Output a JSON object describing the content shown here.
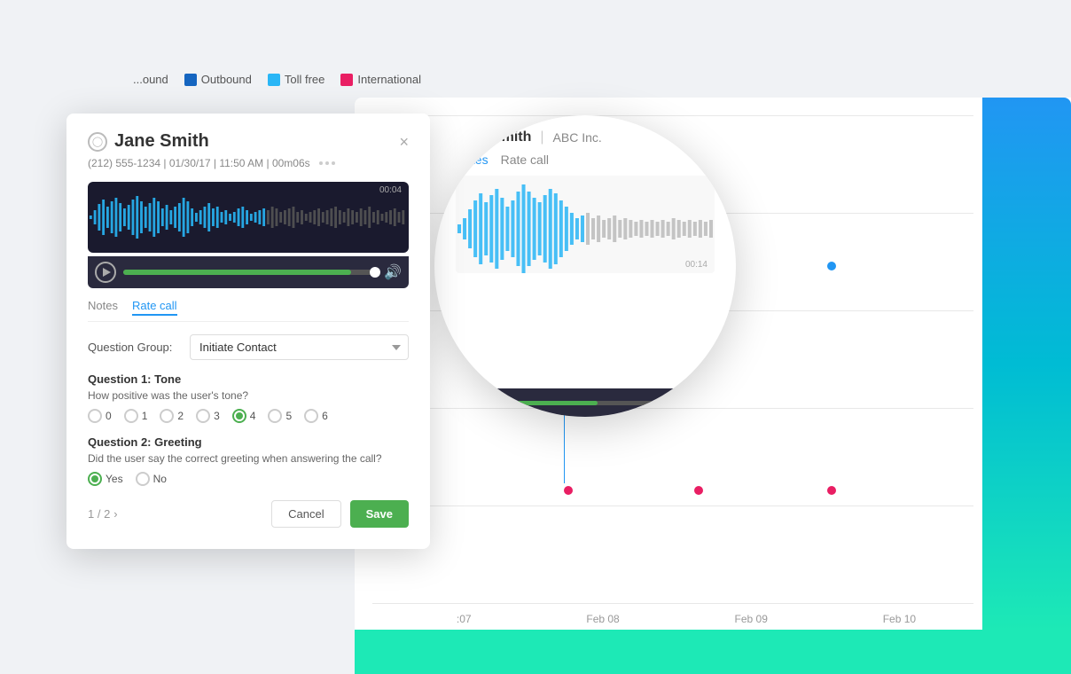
{
  "legend": {
    "items": [
      {
        "label": "Outbound",
        "color": "#1565C0"
      },
      {
        "label": "Toll free",
        "color": "#29B6F6"
      },
      {
        "label": "International",
        "color": "#E91E63"
      }
    ]
  },
  "modal": {
    "title": "Jane Smith",
    "close_label": "×",
    "meta": "(212) 555-1234 | 01/30/17 | 11:50 AM | 00m06s",
    "waveform_time": "00:04",
    "tabs": [
      {
        "label": "Notes",
        "active": false
      },
      {
        "label": "Rate call",
        "active": true
      }
    ],
    "form": {
      "question_group_label": "Question Group:",
      "question_group_value": "Initiate Contact",
      "questions": [
        {
          "title": "Question 1: Tone",
          "text": "How positive was the user's tone?",
          "type": "scale",
          "options": [
            "0",
            "1",
            "2",
            "3",
            "4",
            "5",
            "6"
          ],
          "selected": "4"
        },
        {
          "title": "Question 2: Greeting",
          "text": "Did the user say the correct greeting when answering the call?",
          "type": "yesno",
          "options": [
            "Yes",
            "No"
          ],
          "selected": "Yes"
        }
      ]
    },
    "pagination": "1 / 2",
    "cancel_label": "Cancel",
    "save_label": "Save"
  },
  "zoom_popup": {
    "name": "Jane Smith",
    "separator": "|",
    "company": "ABC Inc.",
    "tabs": [
      {
        "label": "Notes",
        "active": true
      },
      {
        "label": "Rate call",
        "active": false
      }
    ],
    "waveform_time": "00:14"
  },
  "chart": {
    "xaxis_labels": [
      ":07",
      "Feb 08",
      "Feb 09",
      "Feb 10"
    ]
  }
}
